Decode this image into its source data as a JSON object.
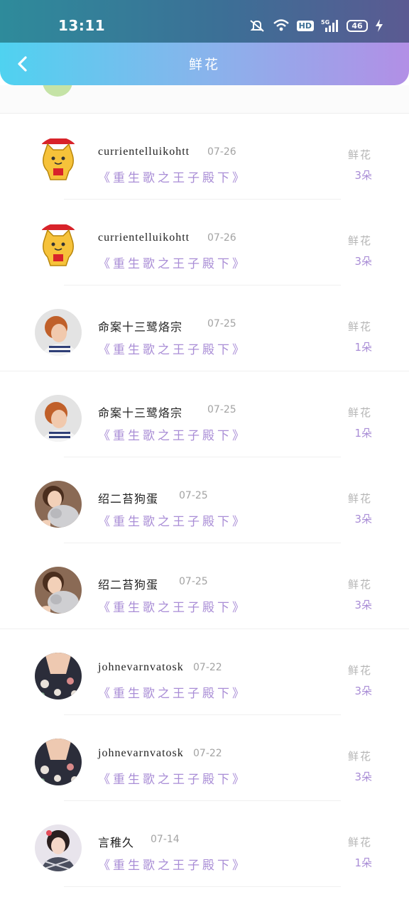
{
  "status_bar": {
    "time": "13:11",
    "network": "HD",
    "signal": "5G",
    "battery": "46"
  },
  "nav": {
    "title": "鲜花"
  },
  "rows": [
    {
      "username": "currientelluikohtt",
      "date": "07-26",
      "book": "《重生歌之王子殿下》",
      "gift_label": "鲜花",
      "gift_count": "3朵",
      "avatar": "cat-avatar-icon"
    },
    {
      "username": "currientelluikohtt",
      "date": "07-26",
      "book": "《重生歌之王子殿下》",
      "gift_label": "鲜花",
      "gift_count": "3朵",
      "avatar": "cat-avatar-icon"
    },
    {
      "username": "命案十三鹭烙宗",
      "date": "07-25",
      "book": "《重生歌之王子殿下》",
      "gift_label": "鲜花",
      "gift_count": "1朵",
      "avatar": "photo-avatar"
    },
    {
      "username": "命案十三鹭烙宗",
      "date": "07-25",
      "book": "《重生歌之王子殿下》",
      "gift_label": "鲜花",
      "gift_count": "1朵",
      "avatar": "photo-avatar"
    },
    {
      "username": "绍二苔狗蛋",
      "date": "07-25",
      "book": "《重生歌之王子殿下》",
      "gift_label": "鲜花",
      "gift_count": "3朵",
      "avatar": "photo-avatar"
    },
    {
      "username": "绍二苔狗蛋",
      "date": "07-25",
      "book": "《重生歌之王子殿下》",
      "gift_label": "鲜花",
      "gift_count": "3朵",
      "avatar": "photo-avatar"
    },
    {
      "username": "johnevarnvatosk",
      "date": "07-22",
      "book": "《重生歌之王子殿下》",
      "gift_label": "鲜花",
      "gift_count": "3朵",
      "avatar": "photo-avatar"
    },
    {
      "username": "johnevarnvatosk",
      "date": "07-22",
      "book": "《重生歌之王子殿下》",
      "gift_label": "鲜花",
      "gift_count": "3朵",
      "avatar": "photo-avatar"
    },
    {
      "username": "言稚久",
      "date": "07-14",
      "book": "《重生歌之王子殿下》",
      "gift_label": "鲜花",
      "gift_count": "1朵",
      "avatar": "photo-avatar"
    }
  ],
  "colors": {
    "accent_purple": "#a98dd6",
    "nav_start": "#4fd2f0",
    "nav_end": "#b28fe6"
  }
}
